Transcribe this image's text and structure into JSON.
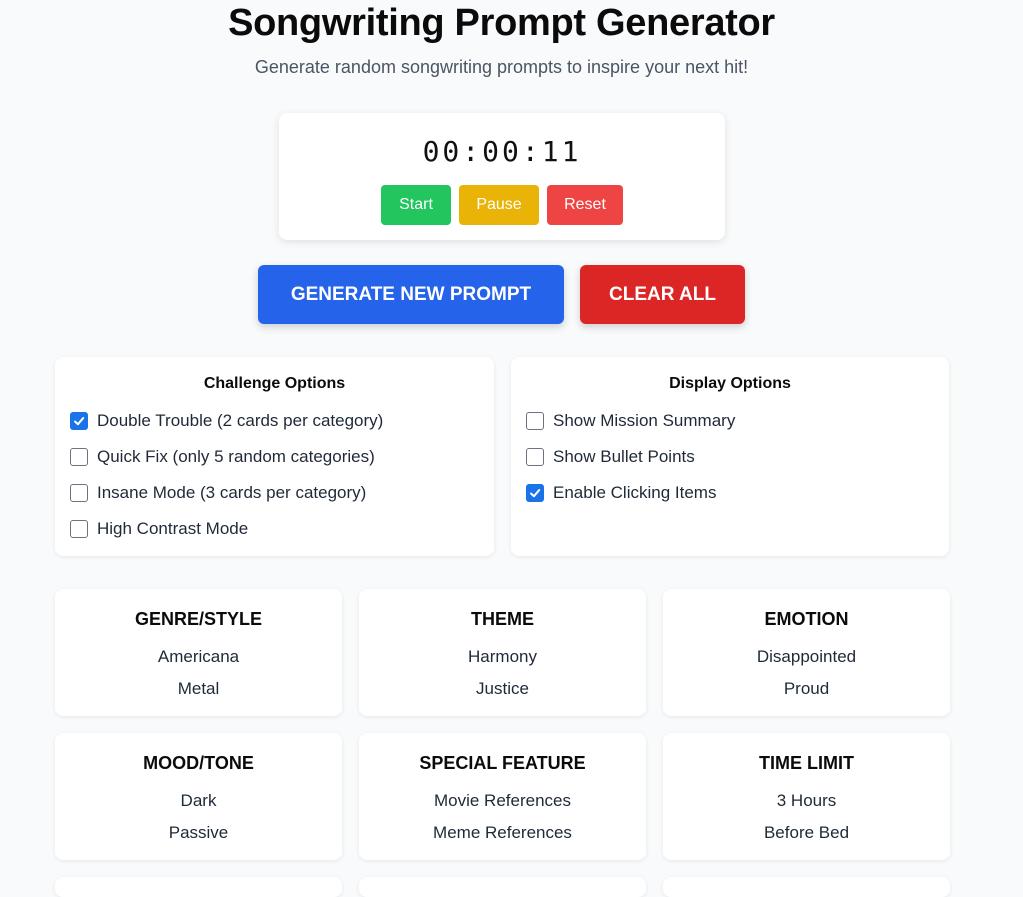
{
  "header": {
    "title": "Songwriting Prompt Generator",
    "subtitle": "Generate random songwriting prompts to inspire your next hit!"
  },
  "timer": {
    "display": "00:00:11",
    "start_label": "Start",
    "pause_label": "Pause",
    "reset_label": "Reset"
  },
  "actions": {
    "generate_label": "GENERATE NEW PROMPT",
    "clear_label": "CLEAR ALL"
  },
  "challenge_options": {
    "title": "Challenge Options",
    "items": [
      {
        "label": "Double Trouble (2 cards per category)",
        "checked": true
      },
      {
        "label": "Quick Fix (only 5 random categories)",
        "checked": false
      },
      {
        "label": "Insane Mode (3 cards per category)",
        "checked": false
      },
      {
        "label": "High Contrast Mode",
        "checked": false
      }
    ]
  },
  "display_options": {
    "title": "Display Options",
    "items": [
      {
        "label": "Show Mission Summary",
        "checked": false
      },
      {
        "label": "Show Bullet Points",
        "checked": false
      },
      {
        "label": "Enable Clicking Items",
        "checked": true
      }
    ]
  },
  "categories": [
    {
      "title": "GENRE/STYLE",
      "items": [
        "Americana",
        "Metal"
      ]
    },
    {
      "title": "THEME",
      "items": [
        "Harmony",
        "Justice"
      ]
    },
    {
      "title": "EMOTION",
      "items": [
        "Disappointed",
        "Proud"
      ]
    },
    {
      "title": "MOOD/TONE",
      "items": [
        "Dark",
        "Passive"
      ]
    },
    {
      "title": "SPECIAL FEATURE",
      "items": [
        "Movie References",
        "Meme References"
      ]
    },
    {
      "title": "TIME LIMIT",
      "items": [
        "3 Hours",
        "Before Bed"
      ]
    }
  ],
  "colors": {
    "primary": "#2563eb",
    "danger": "#dc2626",
    "start": "#22c55e",
    "pause": "#eab308",
    "reset": "#ef4444",
    "checkbox_checked": "#1a73e8"
  }
}
